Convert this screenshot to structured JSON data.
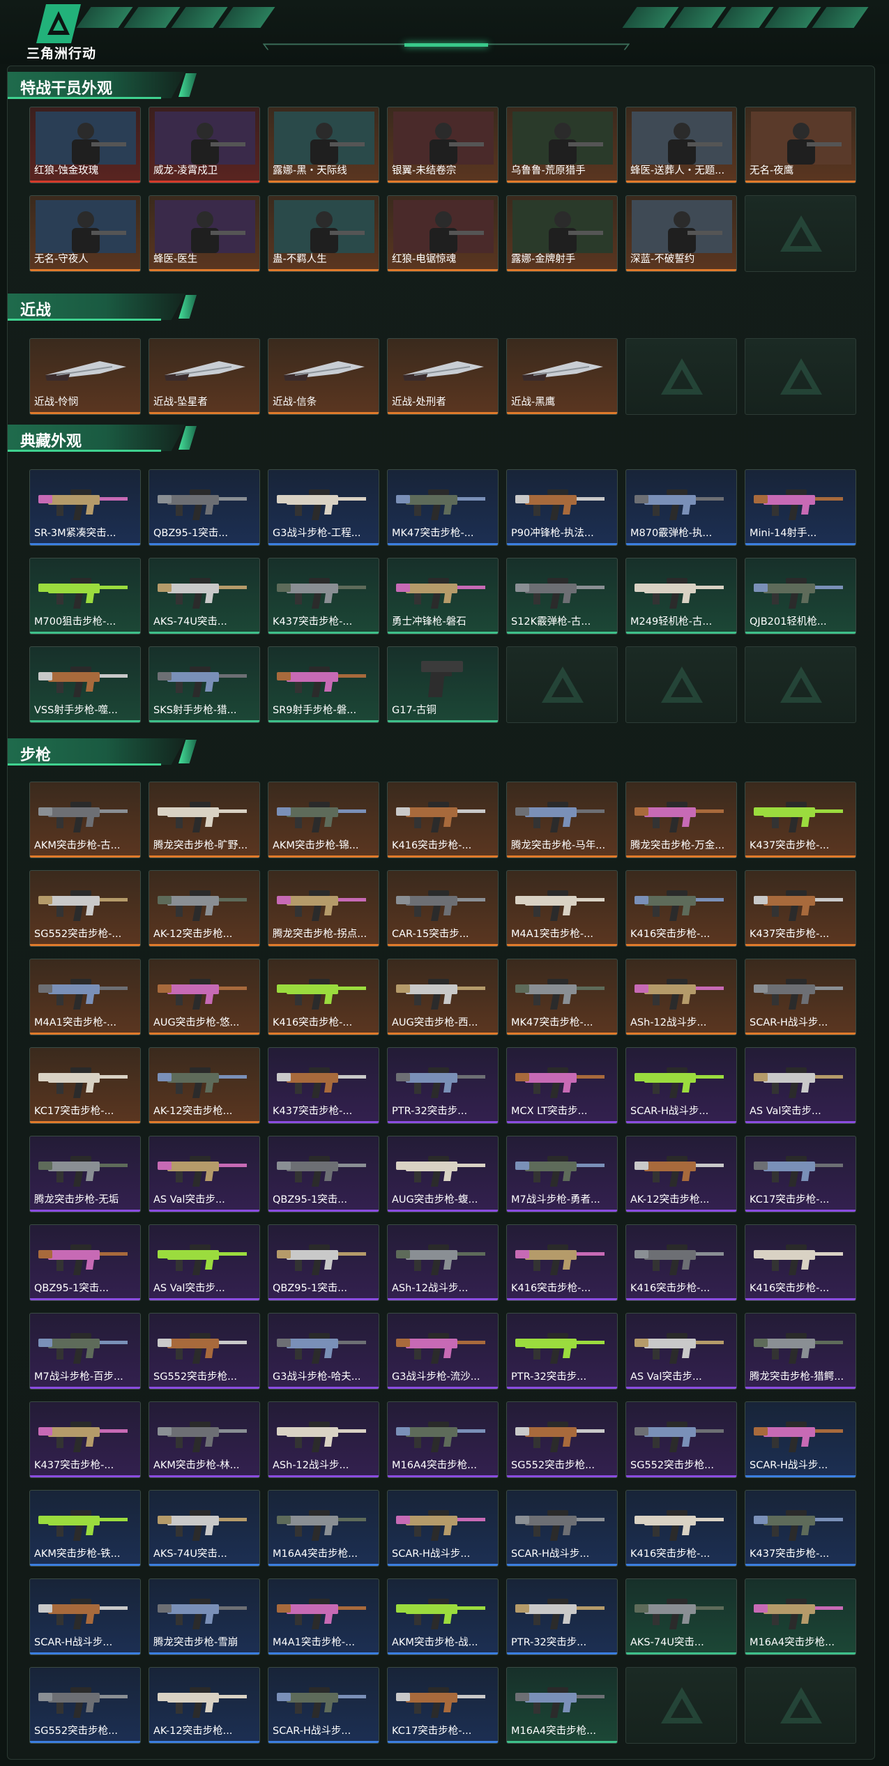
{
  "app": {
    "logo_text": "三角洲行动"
  },
  "sections": [
    {
      "title": "特战干员外观",
      "items": [
        {
          "label": "红狼-蚀金玫瑰",
          "rarity": "red",
          "kind": "operator"
        },
        {
          "label": "威龙-凌霄戍卫",
          "rarity": "red",
          "kind": "operator"
        },
        {
          "label": "露娜-黑・天际线",
          "rarity": "gold",
          "kind": "operator"
        },
        {
          "label": "银翼-未结卷宗",
          "rarity": "gold",
          "kind": "operator"
        },
        {
          "label": "乌鲁鲁-荒原猎手",
          "rarity": "gold",
          "kind": "operator"
        },
        {
          "label": "蜂医-送葬人・无题...",
          "rarity": "gold",
          "kind": "operator"
        },
        {
          "label": "无名-夜鹰",
          "rarity": "gold",
          "kind": "operator"
        },
        {
          "label": "无名-守夜人",
          "rarity": "gold",
          "kind": "operator"
        },
        {
          "label": "蜂医-医生",
          "rarity": "gold",
          "kind": "operator"
        },
        {
          "label": "蛊-不羁人生",
          "rarity": "gold",
          "kind": "operator"
        },
        {
          "label": "红狼-电锯惊魂",
          "rarity": "gold",
          "kind": "operator"
        },
        {
          "label": "露娜-金牌射手",
          "rarity": "gold",
          "kind": "operator"
        },
        {
          "label": "深蓝-不破誓约",
          "rarity": "gold",
          "kind": "operator"
        },
        {
          "label": "",
          "rarity": "empty",
          "kind": "empty"
        }
      ]
    },
    {
      "title": "近战",
      "items": [
        {
          "label": "近战-怜悯",
          "rarity": "gold",
          "kind": "melee"
        },
        {
          "label": "近战-坠星者",
          "rarity": "gold",
          "kind": "melee"
        },
        {
          "label": "近战-信条",
          "rarity": "gold",
          "kind": "melee"
        },
        {
          "label": "近战-处刑者",
          "rarity": "gold",
          "kind": "melee"
        },
        {
          "label": "近战-黑鹰",
          "rarity": "gold",
          "kind": "melee"
        },
        {
          "label": "",
          "rarity": "empty",
          "kind": "empty"
        },
        {
          "label": "",
          "rarity": "empty",
          "kind": "empty"
        }
      ]
    },
    {
      "title": "典藏外观",
      "items": [
        {
          "label": "SR-3M紧凑突击...",
          "rarity": "blue",
          "kind": "gun"
        },
        {
          "label": "QBZ95-1突击...",
          "rarity": "blue",
          "kind": "gun"
        },
        {
          "label": "G3战斗步枪-工程...",
          "rarity": "blue",
          "kind": "gun"
        },
        {
          "label": "MK47突击步枪-...",
          "rarity": "blue",
          "kind": "gun"
        },
        {
          "label": "P90冲锋枪-执法...",
          "rarity": "blue",
          "kind": "gun"
        },
        {
          "label": "M870霰弹枪-执...",
          "rarity": "blue",
          "kind": "gun"
        },
        {
          "label": "Mini-14射手...",
          "rarity": "blue",
          "kind": "gun"
        },
        {
          "label": "M700狙击步枪-...",
          "rarity": "green",
          "kind": "gun"
        },
        {
          "label": "AKS-74U突击...",
          "rarity": "green",
          "kind": "gun"
        },
        {
          "label": "K437突击步枪-...",
          "rarity": "green",
          "kind": "gun"
        },
        {
          "label": "勇士冲锋枪-磐石",
          "rarity": "green",
          "kind": "gun"
        },
        {
          "label": "S12K霰弹枪-古...",
          "rarity": "green",
          "kind": "gun"
        },
        {
          "label": "M249轻机枪-古...",
          "rarity": "green",
          "kind": "gun"
        },
        {
          "label": "QJB201轻机枪...",
          "rarity": "green",
          "kind": "gun"
        },
        {
          "label": "VSS射手步枪-噬...",
          "rarity": "green",
          "kind": "gun"
        },
        {
          "label": "SKS射手步枪-猎...",
          "rarity": "green",
          "kind": "gun"
        },
        {
          "label": "SR9射手步枪-磐...",
          "rarity": "green",
          "kind": "gun"
        },
        {
          "label": "G17-古铜",
          "rarity": "green",
          "kind": "pistol"
        },
        {
          "label": "",
          "rarity": "empty",
          "kind": "empty"
        },
        {
          "label": "",
          "rarity": "empty",
          "kind": "empty"
        },
        {
          "label": "",
          "rarity": "empty",
          "kind": "empty"
        }
      ]
    },
    {
      "title": "步枪",
      "items": [
        {
          "label": "AKM突击步枪-古...",
          "rarity": "gold",
          "kind": "gun"
        },
        {
          "label": "腾龙突击步枪-旷野...",
          "rarity": "gold",
          "kind": "gun"
        },
        {
          "label": "AKM突击步枪-锦...",
          "rarity": "gold",
          "kind": "gun"
        },
        {
          "label": "K416突击步枪-...",
          "rarity": "gold",
          "kind": "gun"
        },
        {
          "label": "腾龙突击步枪-马年...",
          "rarity": "gold",
          "kind": "gun"
        },
        {
          "label": "腾龙突击步枪-万金...",
          "rarity": "gold",
          "kind": "gun"
        },
        {
          "label": "K437突击步枪-...",
          "rarity": "gold",
          "kind": "gun"
        },
        {
          "label": "SG552突击步枪-...",
          "rarity": "gold",
          "kind": "gun"
        },
        {
          "label": "AK-12突击步枪...",
          "rarity": "gold",
          "kind": "gun"
        },
        {
          "label": "腾龙突击步枪-拐点...",
          "rarity": "gold",
          "kind": "gun"
        },
        {
          "label": "CAR-15突击步...",
          "rarity": "gold",
          "kind": "gun"
        },
        {
          "label": "M4A1突击步枪-...",
          "rarity": "gold",
          "kind": "gun"
        },
        {
          "label": "K416突击步枪-...",
          "rarity": "gold",
          "kind": "gun"
        },
        {
          "label": "K437突击步枪-...",
          "rarity": "gold",
          "kind": "gun"
        },
        {
          "label": "M4A1突击步枪-...",
          "rarity": "gold",
          "kind": "gun"
        },
        {
          "label": "AUG突击步枪-悠...",
          "rarity": "gold",
          "kind": "gun"
        },
        {
          "label": "K416突击步枪-...",
          "rarity": "gold",
          "kind": "gun"
        },
        {
          "label": "AUG突击步枪-西...",
          "rarity": "gold",
          "kind": "gun"
        },
        {
          "label": "MK47突击步枪-...",
          "rarity": "gold",
          "kind": "gun"
        },
        {
          "label": "ASh-12战斗步...",
          "rarity": "gold",
          "kind": "gun"
        },
        {
          "label": "SCAR-H战斗步...",
          "rarity": "gold",
          "kind": "gun"
        },
        {
          "label": "KC17突击步枪-...",
          "rarity": "gold",
          "kind": "gun"
        },
        {
          "label": "AK-12突击步枪...",
          "rarity": "gold",
          "kind": "gun"
        },
        {
          "label": "K437突击步枪-...",
          "rarity": "purple",
          "kind": "gun"
        },
        {
          "label": "PTR-32突击步...",
          "rarity": "purple",
          "kind": "gun"
        },
        {
          "label": "MCX LT突击步...",
          "rarity": "purple",
          "kind": "gun"
        },
        {
          "label": "SCAR-H战斗步...",
          "rarity": "purple",
          "kind": "gun"
        },
        {
          "label": "AS Val突击步...",
          "rarity": "purple",
          "kind": "gun"
        },
        {
          "label": "腾龙突击步枪-无垢",
          "rarity": "purple",
          "kind": "gun"
        },
        {
          "label": "AS Val突击步...",
          "rarity": "purple",
          "kind": "gun"
        },
        {
          "label": "QBZ95-1突击...",
          "rarity": "purple",
          "kind": "gun"
        },
        {
          "label": "AUG突击步枪-蝮...",
          "rarity": "purple",
          "kind": "gun"
        },
        {
          "label": "M7战斗步枪-勇者...",
          "rarity": "purple",
          "kind": "gun"
        },
        {
          "label": "AK-12突击步枪...",
          "rarity": "purple",
          "kind": "gun"
        },
        {
          "label": "KC17突击步枪-...",
          "rarity": "purple",
          "kind": "gun"
        },
        {
          "label": "QBZ95-1突击...",
          "rarity": "purple",
          "kind": "gun"
        },
        {
          "label": "AS Val突击步...",
          "rarity": "purple",
          "kind": "gun"
        },
        {
          "label": "QBZ95-1突击...",
          "rarity": "purple",
          "kind": "gun"
        },
        {
          "label": "ASh-12战斗步...",
          "rarity": "purple",
          "kind": "gun"
        },
        {
          "label": "K416突击步枪-...",
          "rarity": "purple",
          "kind": "gun"
        },
        {
          "label": "K416突击步枪-...",
          "rarity": "purple",
          "kind": "gun"
        },
        {
          "label": "K416突击步枪-...",
          "rarity": "purple",
          "kind": "gun"
        },
        {
          "label": "M7战斗步枪-百步...",
          "rarity": "purple",
          "kind": "gun"
        },
        {
          "label": "SG552突击步枪...",
          "rarity": "purple",
          "kind": "gun"
        },
        {
          "label": "G3战斗步枪-哈夫...",
          "rarity": "purple",
          "kind": "gun"
        },
        {
          "label": "G3战斗步枪-流沙...",
          "rarity": "purple",
          "kind": "gun"
        },
        {
          "label": "PTR-32突击步...",
          "rarity": "purple",
          "kind": "gun"
        },
        {
          "label": "AS Val突击步...",
          "rarity": "purple",
          "kind": "gun"
        },
        {
          "label": "腾龙突击步枪-猎鳄...",
          "rarity": "purple",
          "kind": "gun"
        },
        {
          "label": "K437突击步枪-...",
          "rarity": "purple",
          "kind": "gun"
        },
        {
          "label": "AKM突击步枪-林...",
          "rarity": "purple",
          "kind": "gun"
        },
        {
          "label": "ASh-12战斗步...",
          "rarity": "purple",
          "kind": "gun"
        },
        {
          "label": "M16A4突击步枪...",
          "rarity": "purple",
          "kind": "gun"
        },
        {
          "label": "SG552突击步枪...",
          "rarity": "purple",
          "kind": "gun"
        },
        {
          "label": "SG552突击步枪...",
          "rarity": "purple",
          "kind": "gun"
        },
        {
          "label": "SCAR-H战斗步...",
          "rarity": "blue",
          "kind": "gun"
        },
        {
          "label": "AKM突击步枪-铁...",
          "rarity": "blue",
          "kind": "gun"
        },
        {
          "label": "AKS-74U突击...",
          "rarity": "blue",
          "kind": "gun"
        },
        {
          "label": "M16A4突击步枪...",
          "rarity": "blue",
          "kind": "gun"
        },
        {
          "label": "SCAR-H战斗步...",
          "rarity": "blue",
          "kind": "gun"
        },
        {
          "label": "SCAR-H战斗步...",
          "rarity": "blue",
          "kind": "gun"
        },
        {
          "label": "K416突击步枪-...",
          "rarity": "blue",
          "kind": "gun"
        },
        {
          "label": "K437突击步枪-...",
          "rarity": "blue",
          "kind": "gun"
        },
        {
          "label": "SCAR-H战斗步...",
          "rarity": "blue",
          "kind": "gun"
        },
        {
          "label": "腾龙突击步枪-雪崩",
          "rarity": "blue",
          "kind": "gun"
        },
        {
          "label": "M4A1突击步枪-...",
          "rarity": "blue",
          "kind": "gun"
        },
        {
          "label": "AKM突击步枪-战...",
          "rarity": "blue",
          "kind": "gun"
        },
        {
          "label": "PTR-32突击步...",
          "rarity": "blue",
          "kind": "gun"
        },
        {
          "label": "AKS-74U突击...",
          "rarity": "green",
          "kind": "gun"
        },
        {
          "label": "M16A4突击步枪...",
          "rarity": "green",
          "kind": "gun"
        },
        {
          "label": "SG552突击步枪...",
          "rarity": "blue",
          "kind": "gun"
        },
        {
          "label": "AK-12突击步枪...",
          "rarity": "blue",
          "kind": "gun"
        },
        {
          "label": "SCAR-H战斗步...",
          "rarity": "blue",
          "kind": "gun"
        },
        {
          "label": "KC17突击步枪-...",
          "rarity": "blue",
          "kind": "gun"
        },
        {
          "label": "M16A4突击步枪...",
          "rarity": "green",
          "kind": "gun"
        },
        {
          "label": "",
          "rarity": "empty",
          "kind": "empty"
        },
        {
          "label": "",
          "rarity": "empty",
          "kind": "empty"
        }
      ]
    }
  ],
  "colors": {
    "accent": "#3fd18f",
    "gold": "#e07a2b",
    "red": "#d33b2b",
    "purple": "#8a4ce0",
    "blue": "#3b7ee0",
    "green": "#3ec08a"
  }
}
